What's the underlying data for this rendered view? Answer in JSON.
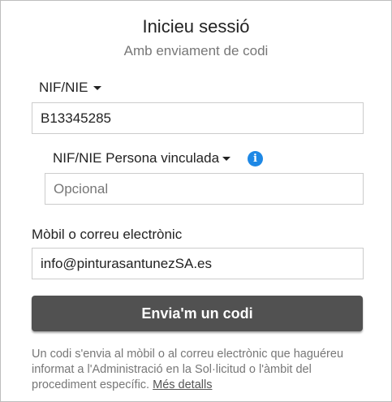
{
  "header": {
    "title": "Inicieu sessió",
    "subtitle": "Amb enviament de codi"
  },
  "nif_field": {
    "label": "NIF/NIE",
    "value": "B13345285"
  },
  "linked_person_field": {
    "label": "NIF/NIE Persona vinculada",
    "placeholder": "Opcional",
    "value": "",
    "info_icon": "info-icon",
    "info_color": "#1e88e5"
  },
  "contact_field": {
    "label": "Mòbil o correu electrònic",
    "value": "info@pinturasantunezSA.es"
  },
  "submit": {
    "label": "Envia'm un codi",
    "color": "#515151"
  },
  "note": {
    "text": "Un codi s'envia al mòbil o al correu electrònic que haguéreu informat a l'Administració en la Sol·licitud o l'àmbit del procediment específic.",
    "link_label": "Més detalls"
  }
}
